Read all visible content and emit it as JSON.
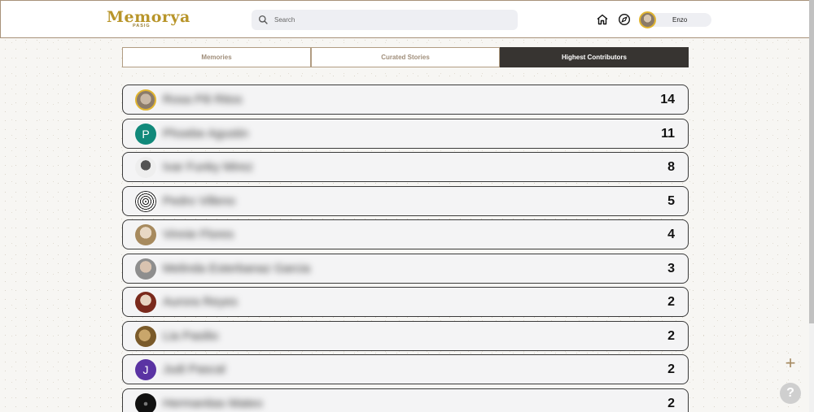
{
  "brand": {
    "name": "Memorya",
    "sub": "PASIG"
  },
  "search": {
    "placeholder": "Search"
  },
  "header": {
    "user_name": "Enzo"
  },
  "tabs": [
    {
      "label": "Memories"
    },
    {
      "label": "Curated Stories"
    },
    {
      "label": "Highest Contributors"
    }
  ],
  "contributors": [
    {
      "name": "Rosa Pili Ritos",
      "count": "14",
      "avatar": "photo"
    },
    {
      "name": "Phoebe Agustin",
      "count": "11",
      "avatar": "P",
      "color": "#11897a"
    },
    {
      "name": "Ivar Funky Mirez",
      "count": "8",
      "avatar": "photo"
    },
    {
      "name": "Pedro Villeno",
      "count": "5",
      "avatar": "photo"
    },
    {
      "name": "Vinnie Flores",
      "count": "4",
      "avatar": "photo"
    },
    {
      "name": "Melinda Esterbanaz Garcia",
      "count": "3",
      "avatar": "photo"
    },
    {
      "name": "Aurora Reyes",
      "count": "2",
      "avatar": "photo"
    },
    {
      "name": "Lia Pasilio",
      "count": "2",
      "avatar": "photo"
    },
    {
      "name": "Judi Pascal",
      "count": "2",
      "avatar": "J",
      "color": "#5a33a3"
    },
    {
      "name": "Hermanitas Mateo",
      "count": "2",
      "avatar": "photo"
    }
  ],
  "icons": {
    "add": "plus-icon",
    "help": "help-icon"
  }
}
